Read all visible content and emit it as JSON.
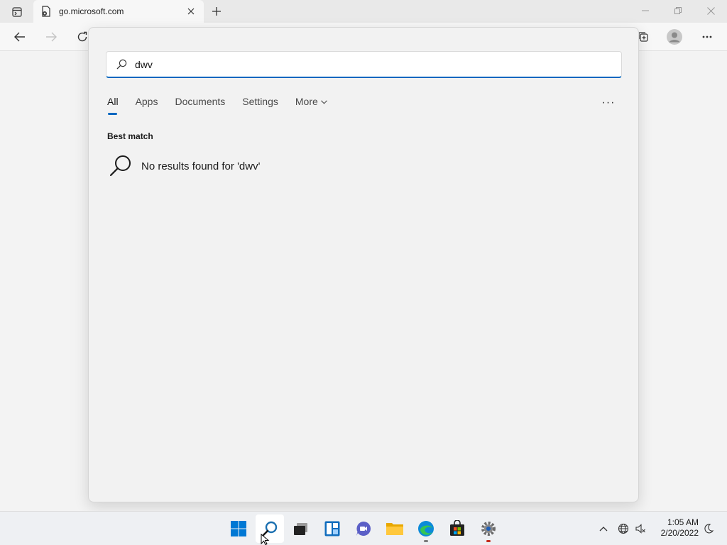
{
  "browser": {
    "tab_title": "go.microsoft.com",
    "new_tab_label": "+"
  },
  "search": {
    "query": "dwv",
    "tabs": [
      {
        "label": "All",
        "active": true
      },
      {
        "label": "Apps"
      },
      {
        "label": "Documents"
      },
      {
        "label": "Settings"
      },
      {
        "label": "More",
        "dropdown": true
      }
    ],
    "more_options": "···",
    "section_heading": "Best match",
    "no_results_message": "No results found for 'dwv'"
  },
  "taskbar": {
    "apps": [
      {
        "name": "start-button",
        "icon": "windows-logo-icon"
      },
      {
        "name": "search-button",
        "icon": "search-icon",
        "active": true
      },
      {
        "name": "task-view-button",
        "icon": "task-view-icon"
      },
      {
        "name": "widgets-button",
        "icon": "widgets-icon"
      },
      {
        "name": "teams-chat-button",
        "icon": "chat-icon"
      },
      {
        "name": "file-explorer-button",
        "icon": "folder-icon"
      },
      {
        "name": "edge-button",
        "icon": "edge-icon",
        "running": true
      },
      {
        "name": "store-button",
        "icon": "store-icon"
      },
      {
        "name": "settings-button",
        "icon": "gear-icon",
        "running": true
      }
    ],
    "clock": {
      "time": "1:05 AM",
      "date": "2/20/2022"
    }
  },
  "colors": {
    "accent": "#0067c0",
    "background": "#f3f3f3",
    "flyout": "#f2f2f2"
  }
}
